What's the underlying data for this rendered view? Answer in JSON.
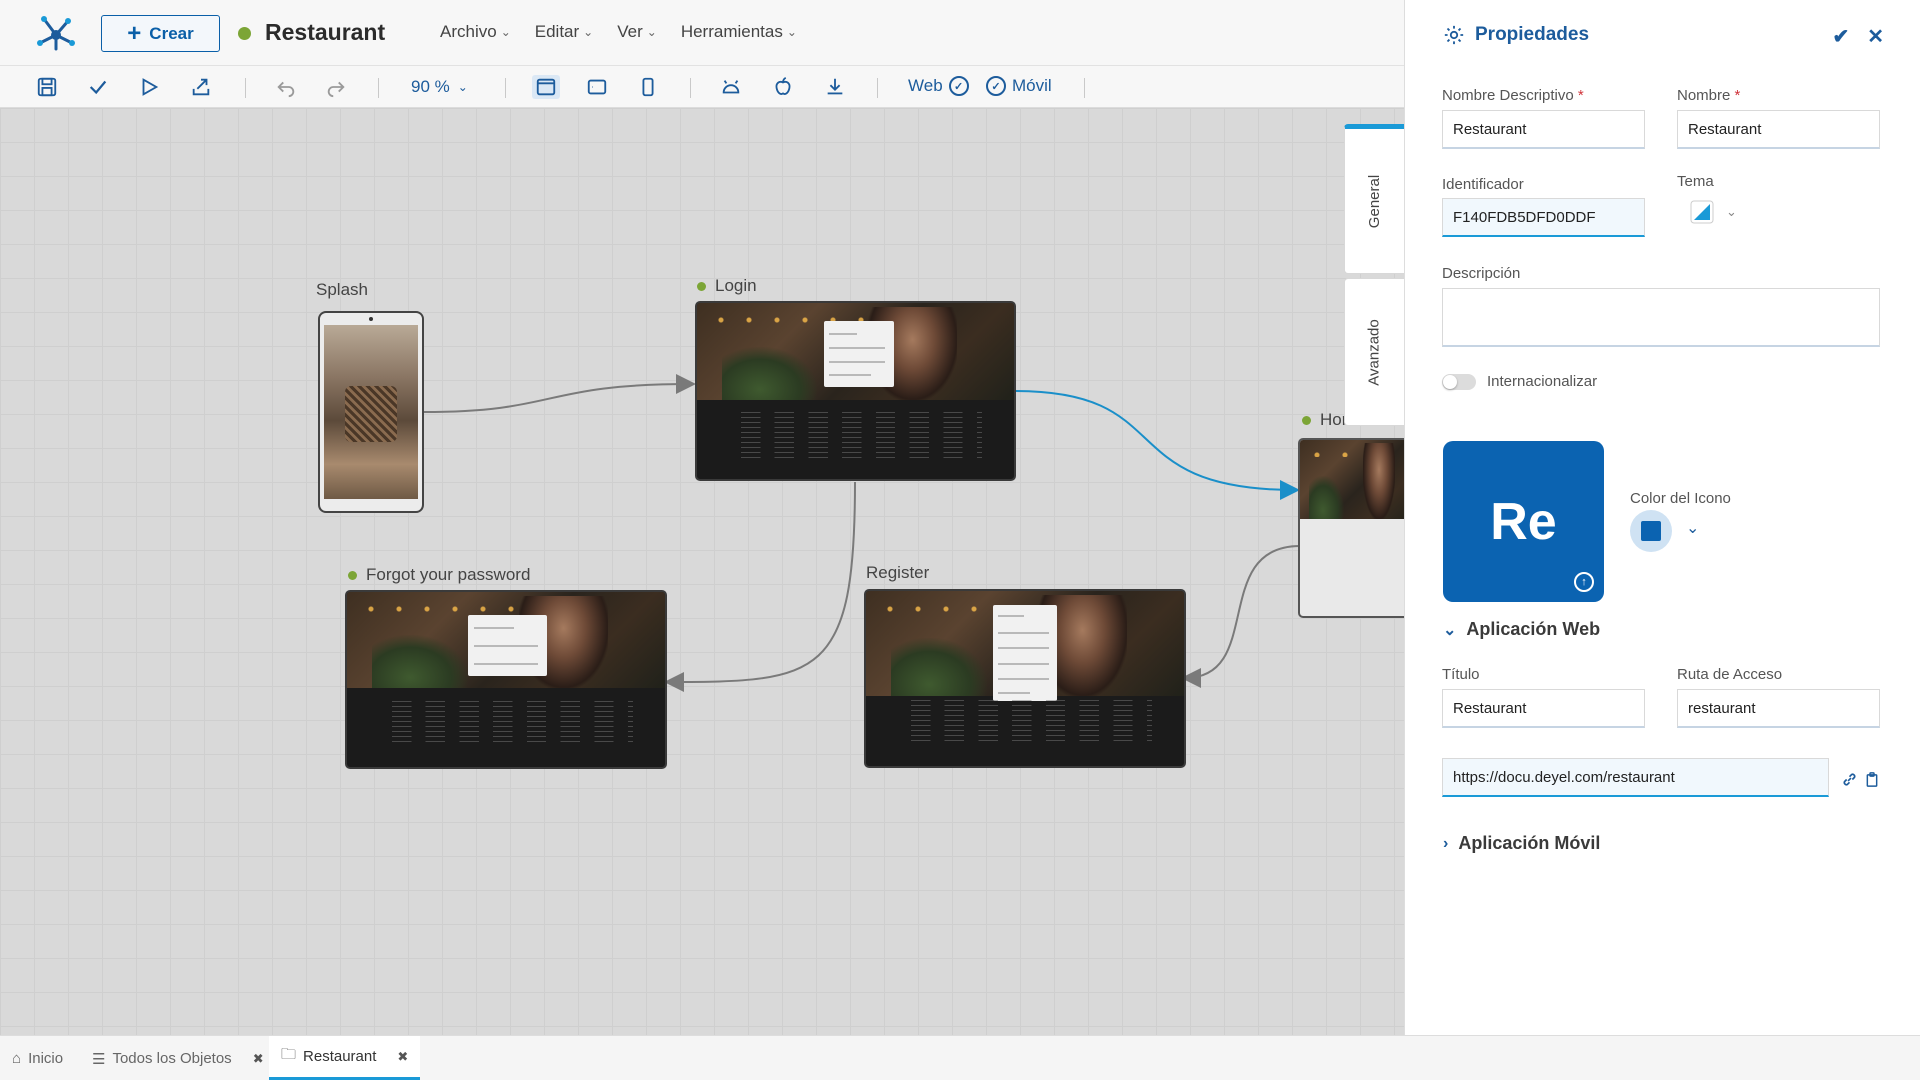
{
  "header": {
    "create_label": "Crear",
    "app_title": "Restaurant",
    "menu": [
      "Archivo",
      "Editar",
      "Ver",
      "Herramientas"
    ]
  },
  "toolbar": {
    "zoom": "90 %",
    "web_label": "Web",
    "movil_label": "Móvil"
  },
  "canvas": {
    "nodes": {
      "splash": "Splash",
      "login": "Login",
      "home": "Home",
      "forgot": "Forgot your password",
      "register": "Register"
    },
    "side_tabs": {
      "general": "General",
      "avanzado": "Avanzado"
    }
  },
  "panel": {
    "title": "Propiedades",
    "nombre_descriptivo_label": "Nombre Descriptivo",
    "nombre_descriptivo_value": "Restaurant",
    "nombre_label": "Nombre",
    "nombre_value": "Restaurant",
    "identificador_label": "Identificador",
    "identificador_value": "F140FDB5DFD0DDF",
    "tema_label": "Tema",
    "descripcion_label": "Descripción",
    "descripcion_value": "",
    "internacionalizar_label": "Internacionalizar",
    "internacionalizar_on": false,
    "icon_text": "Re",
    "icon_color": "#0b63b1",
    "color_icono_label": "Color del Icono",
    "web_section": "Aplicación Web",
    "titulo_label": "Título",
    "titulo_value": "Restaurant",
    "ruta_label": "Ruta de Acceso",
    "ruta_value": "restaurant",
    "url_value": "https://docu.deyel.com/restaurant",
    "movil_section": "Aplicación Móvil"
  },
  "bottom_tabs": {
    "inicio": "Inicio",
    "todos": "Todos los Objetos",
    "restaurant": "Restaurant"
  },
  "colors": {
    "accent": "#1d5c9c",
    "status_green": "#7ca536",
    "tab_highlight": "#1a9ad7"
  }
}
